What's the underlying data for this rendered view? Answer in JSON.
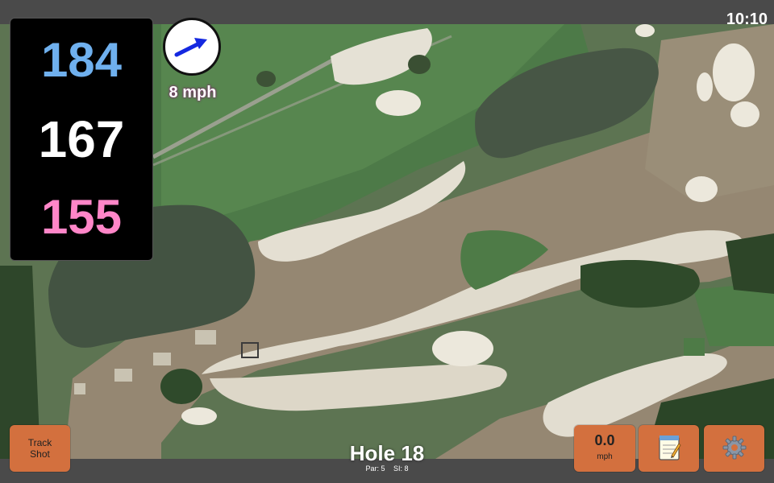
{
  "status": {
    "time": "10:10"
  },
  "distances": {
    "back": "184",
    "center": "167",
    "front": "155",
    "colors": {
      "back": "#6fb0ee",
      "center": "#ffffff",
      "front": "#ff86c8"
    }
  },
  "wind": {
    "direction_icon": "arrow-right-icon",
    "speed_label": "8 mph",
    "speed_value": "0.0",
    "speed_unit": "mph"
  },
  "buttons": {
    "track_shot_label": "Track\nShot",
    "notes_icon": "notepad-icon",
    "settings_icon": "gear-icon",
    "color": "#d3703e"
  },
  "hole": {
    "title": "Hole 18",
    "par": "Par: 5",
    "si": "SI: 8"
  }
}
